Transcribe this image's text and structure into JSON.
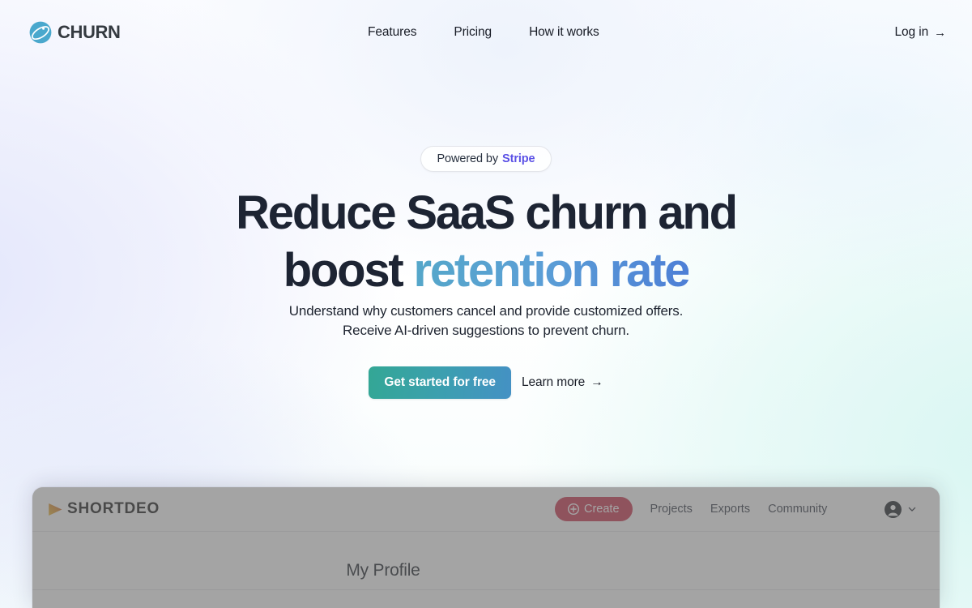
{
  "header": {
    "logo_icon": "churn-orbit-logo-icon",
    "brand": "CHURN",
    "nav": [
      {
        "label": "Features"
      },
      {
        "label": "Pricing"
      },
      {
        "label": "How it works"
      }
    ],
    "login": {
      "label": "Log in",
      "arrow": "→"
    }
  },
  "hero": {
    "badge": {
      "prefix": "Powered by",
      "brand": "Stripe",
      "brand_color": "#5b51e6"
    },
    "headline_line1": "Reduce SaaS churn and",
    "headline_line2_prefix": "boost ",
    "headline_line2_accent": "retention rate",
    "headline_accent_color": "#5299d2",
    "subhead_line1": "Understand why customers cancel and provide customized offers.",
    "subhead_line2": "Receive AI-driven suggestions to prevent churn.",
    "cta_primary": "Get started for free",
    "cta_primary_color": "#33a795",
    "cta_secondary": "Learn more",
    "cta_secondary_arrow": "→"
  },
  "app_preview": {
    "brand_icon": "play-triangle-icon",
    "brand": "SHORTDEO",
    "create_button": {
      "label": "Create",
      "icon": "plus-circle-icon",
      "color": "#c92a45"
    },
    "nav": [
      {
        "label": "Projects"
      },
      {
        "label": "Exports"
      },
      {
        "label": "Community"
      }
    ],
    "account": {
      "avatar_icon": "user-avatar-icon",
      "chevron_icon": "chevron-down-icon"
    },
    "page_title": "My Profile"
  }
}
